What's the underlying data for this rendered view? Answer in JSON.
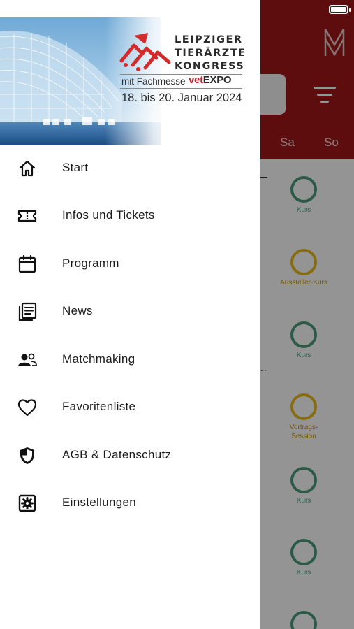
{
  "banner": {
    "title_line1": "LEIPZIGER",
    "title_line2": "TIERÄRZTE",
    "title_line3": "KONGRESS",
    "fachmesse_text": "mit Fachmesse",
    "vetexpo_vet": "vet",
    "vetexpo_expo": "EXPO",
    "dates": "18. bis 20. Januar 2024"
  },
  "menu": {
    "items": [
      {
        "label": "Start",
        "icon": "home-icon"
      },
      {
        "label": "Infos und Tickets",
        "icon": "ticket-icon"
      },
      {
        "label": "Programm",
        "icon": "calendar-icon"
      },
      {
        "label": "News",
        "icon": "newspaper-icon"
      },
      {
        "label": "Matchmaking",
        "icon": "people-icon"
      },
      {
        "label": "Favoritenliste",
        "icon": "heart-icon"
      },
      {
        "label": "AGB & Datenschutz",
        "icon": "shield-icon"
      },
      {
        "label": "Einstellungen",
        "icon": "settings-icon"
      }
    ]
  },
  "background": {
    "day_sa": "Sa",
    "day_so": "So",
    "sessions": [
      {
        "label": "Kurs",
        "color": "green"
      },
      {
        "label": "Aussteller-Kurs",
        "color": "yellow"
      },
      {
        "label": "Kurs",
        "color": "green"
      },
      {
        "label": "Vortrags-\nSession",
        "color": "yellow"
      },
      {
        "label": "Kurs",
        "color": "green"
      },
      {
        "label": "Kurs",
        "color": "green"
      },
      {
        "label": "",
        "color": "green"
      }
    ]
  },
  "colors": {
    "brand_red": "#a01818",
    "green": "#4a9e7c",
    "yellow": "#e8bb1c"
  }
}
